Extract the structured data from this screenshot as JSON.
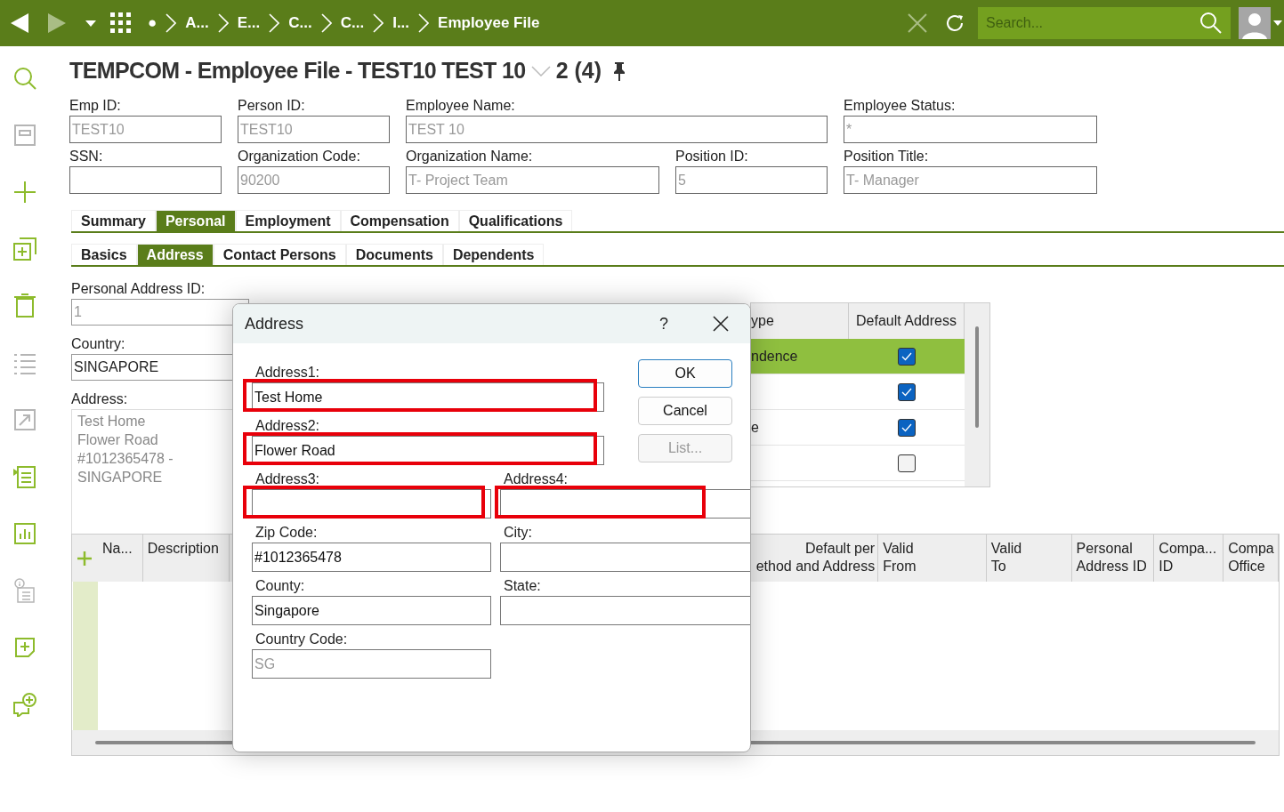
{
  "topbar": {
    "breadcrumbs": [
      "●",
      "A...",
      "E...",
      "C...",
      "C...",
      "I...",
      "Employee File"
    ],
    "search": {
      "placeholder": "Search..."
    }
  },
  "sidebar": {
    "items": [
      {
        "kind": "search",
        "disabled": false
      },
      {
        "kind": "save",
        "disabled": true
      },
      {
        "kind": "add",
        "disabled": false
      },
      {
        "kind": "duplicate",
        "disabled": false
      },
      {
        "kind": "delete",
        "disabled": false
      },
      {
        "kind": "list",
        "disabled": true
      },
      {
        "kind": "export",
        "disabled": true
      },
      {
        "kind": "details",
        "disabled": false
      },
      {
        "kind": "chart",
        "disabled": false
      },
      {
        "kind": "info",
        "disabled": true
      },
      {
        "kind": "note",
        "disabled": false
      },
      {
        "kind": "comment",
        "disabled": false
      }
    ]
  },
  "page_title": {
    "text": "TEMPCOM - Employee File - TEST10  TEST 10",
    "record": "2 (4)"
  },
  "header_fields": [
    [
      {
        "label": "Emp ID:",
        "value": "TEST10",
        "disabled": true
      },
      {
        "label": "Person ID:",
        "value": "TEST10",
        "disabled": true
      },
      {
        "label": "Employee Name:",
        "value": "TEST 10",
        "disabled": true
      },
      {
        "label": "Employee Status:",
        "value": "*",
        "disabled": true
      }
    ],
    [
      {
        "label": "SSN:"
      },
      {
        "label": "Organization Code:",
        "value": "90200",
        "disabled": true
      },
      {
        "label": "Organization Name:",
        "value": "T- Project Team",
        "disabled": true
      },
      {
        "label": "Position ID:",
        "value": "5",
        "disabled": true
      },
      {
        "label": "Position Title:",
        "value": "T- Manager",
        "disabled": true
      }
    ]
  ],
  "tabs": [
    {
      "label": "Summary",
      "selected": false
    },
    {
      "label": "Personal",
      "selected": true
    },
    {
      "label": "Employment",
      "selected": false
    },
    {
      "label": "Compensation",
      "selected": false
    },
    {
      "label": "Qualifications",
      "selected": false
    }
  ],
  "subtabs": [
    {
      "label": "Basics",
      "selected": false
    },
    {
      "label": "Address",
      "selected": true
    },
    {
      "label": "Contact Persons",
      "selected": false
    },
    {
      "label": "Documents",
      "selected": false
    },
    {
      "label": "Dependents",
      "selected": false
    }
  ],
  "address_form": {
    "personal_address_id": {
      "label": "Personal Address ID:",
      "value": "1"
    },
    "country": {
      "label": "Country:",
      "value": "SINGAPORE"
    },
    "address": {
      "label": "Address:",
      "lines": [
        "Test Home",
        "Flower Road",
        "#1012365478 -",
        "SINGAPORE"
      ]
    }
  },
  "type_table": {
    "columns": [
      "ype",
      "Default Address"
    ],
    "rows": [
      {
        "type": "ndence",
        "checked": true,
        "selected": true
      },
      {
        "type": "",
        "checked": true,
        "selected": false
      },
      {
        "type": "e",
        "checked": true,
        "selected": false
      },
      {
        "type": "",
        "checked": false,
        "selected": false
      }
    ]
  },
  "lower_table": {
    "columns": [
      "Na...",
      "Description",
      "Default per\nethod and Address",
      "Valid\nFrom",
      "Valid\nTo",
      "Personal\nAddress ID",
      "Compa...\nID",
      "Compa\nOffice"
    ]
  },
  "dialog": {
    "title": "Address",
    "help": "?",
    "fields": [
      {
        "label": "Address1:",
        "value": "Test Home",
        "disabled": false,
        "highlighted": true
      },
      {
        "label": "Address2:",
        "value": "Flower Road",
        "disabled": false,
        "highlighted": true
      },
      {
        "label": "Address3:",
        "highlighted": true
      },
      {
        "label": "Address4:",
        "highlighted": true
      },
      {
        "label": "Zip Code:",
        "value": "#1012365478",
        "disabled": false
      },
      {
        "label": "City:"
      },
      {
        "label": "County:",
        "value": "Singapore",
        "disabled": false
      },
      {
        "label": "State:"
      },
      {
        "label": "Country Code:",
        "value": "SG",
        "disabled": true
      }
    ],
    "buttons": [
      {
        "label": "OK",
        "focused": true,
        "disabled": false
      },
      {
        "label": "Cancel",
        "focused": false,
        "disabled": false
      },
      {
        "label": "List...",
        "focused": false,
        "disabled": true
      }
    ]
  }
}
